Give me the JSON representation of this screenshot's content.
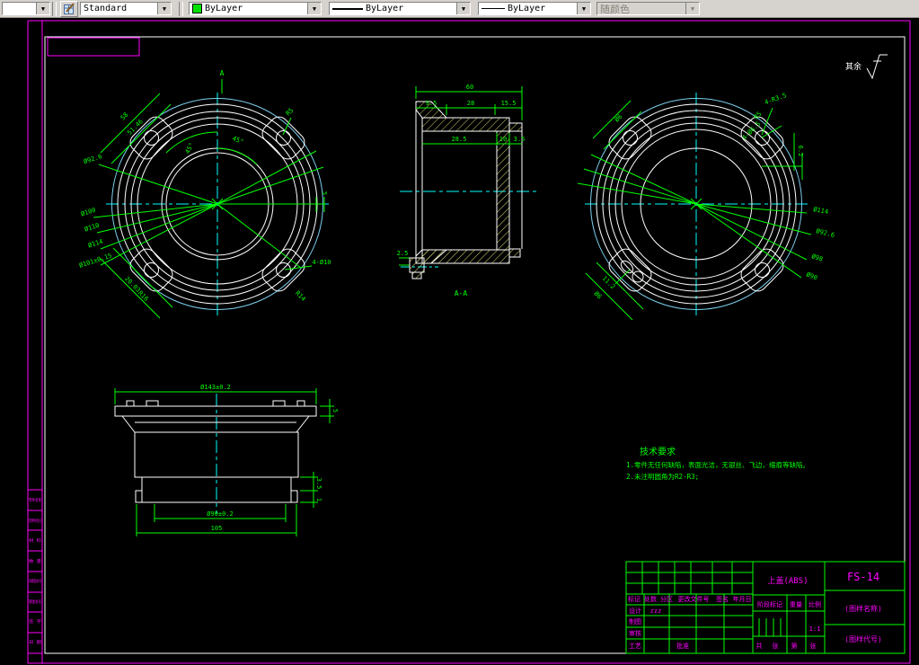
{
  "toolbar": {
    "combo_empty": "",
    "style": "Standard",
    "color": "ByLayer",
    "linetype": "ByLayer",
    "lineweight": "ByLayer",
    "plotstyle": "随颜色"
  },
  "sheet": {
    "surface_note": "其余",
    "section_marker": "A"
  },
  "left_view": {
    "angle_a": "45°",
    "angle_b": "45°",
    "dim_58": "58",
    "dim_5146": "51.46",
    "dia_926": "Ø92.6",
    "dia_100": "Ø100",
    "dia_110": "Ø110",
    "dia_114": "Ø114",
    "dia_101": "Ø101±0.15",
    "dim_2003": "20.03",
    "r16": "R16",
    "holes": "4-Ø10",
    "r14": "R14",
    "r5": "R5",
    "dim_5": "5"
  },
  "section_view": {
    "dim_60": "60",
    "dim_95": "9.5",
    "dim_28": "28",
    "dim_155": "15.5",
    "dim_285": "28.5",
    "dim_10": "10",
    "dim_35": "3.5",
    "dim_25": "2.5",
    "label": "A-A"
  },
  "right_view": {
    "dia_6_tl": "Ø6",
    "r35": "4-R3.5",
    "r5": "R5",
    "holes_65": "4-Ø6.5",
    "dim_62": "6.2",
    "dia_114": "Ø114",
    "dia_926": "Ø92.6",
    "dia_98": "Ø98",
    "dia_90": "Ø90",
    "dim_112": "11.2",
    "dia_6_bl": "Ø6"
  },
  "front_view": {
    "dia_143": "Ø143±0.2",
    "dim_5": "5",
    "dim_35": "3.5",
    "dim_1": "1",
    "dia_90": "Ø90±0.2",
    "dim_105": "105"
  },
  "tech_req": {
    "title": "技术要求",
    "line1": "1.零件无任何缺陷，表面光洁，无银丝、飞边，缩痕等缺陷。",
    "line2": "2.未注明圆角为R2-R3;"
  },
  "title_block": {
    "code": "FS-14",
    "part_name": "上盖(ABS)",
    "name_label": "(图样名称)",
    "code_label": "(图样代号)",
    "header": [
      "标记",
      "处数",
      "分区",
      "更改文件号",
      "签名",
      "年月日"
    ],
    "row_design": "设计",
    "designer": "zzz",
    "row_draft": "制图",
    "row_check": "审核",
    "row_process": "工艺",
    "row_approve": "批准",
    "stage": "阶段标记",
    "weight": "重量",
    "scale": "比例",
    "scale_value": "1:1",
    "sheets": [
      "共",
      "张",
      "第",
      "张"
    ]
  },
  "left_strip": {
    "rows": [
      "零件名称",
      "借用件登记",
      "材 料",
      "数 量",
      "旧底图总号",
      "底图总号",
      "签 字",
      "日 期"
    ]
  }
}
